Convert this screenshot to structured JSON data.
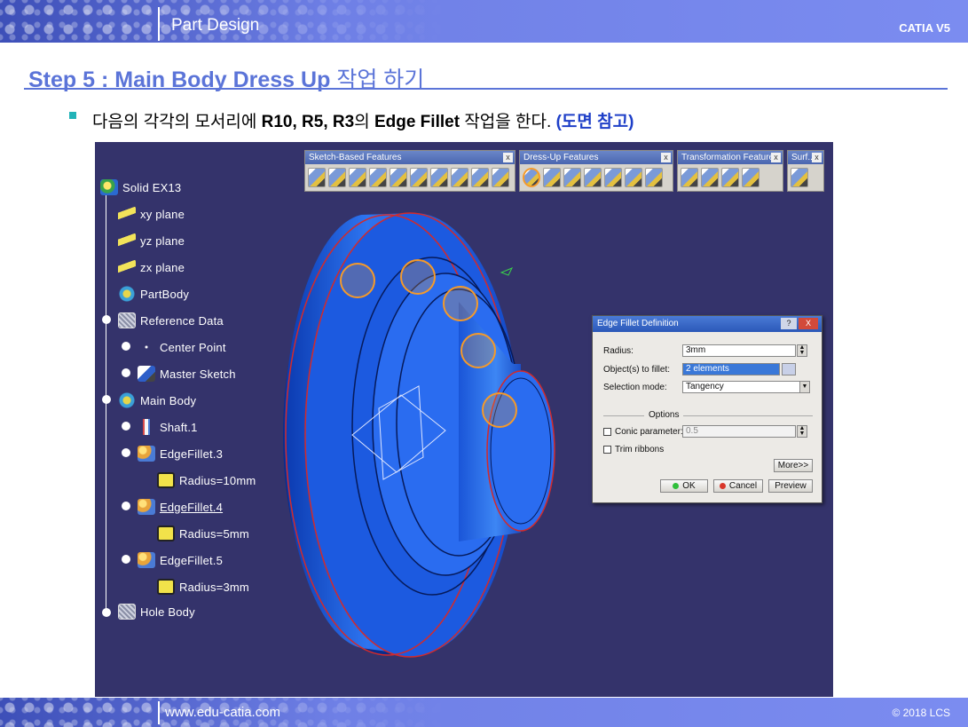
{
  "header": {
    "title": "Part Design",
    "brand": "CATIA V5"
  },
  "step": {
    "title": "Step 5 : Main Body Dress Up",
    "title_kor": "작업 하기"
  },
  "bullet": {
    "text_a": "다음의 각각의 모서리에",
    "text_b": "R10, R5, R3",
    "text_c": "의",
    "text_d": "Edge Fillet",
    "text_e": "작업을 한다.",
    "text_f": "(도면 참고)"
  },
  "tree": {
    "root": "Solid EX13",
    "xy": "xy plane",
    "yz": "yz plane",
    "zx": "zx plane",
    "partbody": "PartBody",
    "refdata": "Reference Data",
    "center": "Center Point",
    "master": "Master Sketch",
    "mainbody": "Main Body",
    "shaft": "Shaft.1",
    "ef3": "EdgeFillet.3",
    "r10": "Radius=10mm",
    "ef4": "EdgeFillet.4",
    "r5": "Radius=5mm",
    "ef5": "EdgeFillet.5",
    "r3": "Radius=3mm",
    "holebody": "Hole Body"
  },
  "toolbars": {
    "sketch": "Sketch-Based Features",
    "dress": "Dress-Up Features",
    "transform": "Transformation Features",
    "surf": "Surf...",
    "close": "x"
  },
  "dialog": {
    "title": "Edge Fillet Definition",
    "help": "?",
    "close": "X",
    "radius_label": "Radius:",
    "radius_value": "3mm",
    "objects_label": "Object(s) to fillet:",
    "objects_value": "2 elements",
    "selection_label": "Selection mode:",
    "selection_value": "Tangency",
    "options": "Options",
    "conic_label": "Conic parameter:",
    "conic_value": "0.5",
    "trim_label": "Trim ribbons",
    "more": "More>>",
    "ok": "OK",
    "cancel": "Cancel",
    "preview": "Preview"
  },
  "footer": {
    "url": "www.edu-catia.com",
    "copyright": "© 2018 LCS"
  },
  "colors": {
    "accent": "#5b74d8",
    "viewport_bg": "#34336b",
    "part_blue": "#1f5fe0",
    "callout_orange": "#f59a2a",
    "edge_red": "#d42a2a"
  }
}
